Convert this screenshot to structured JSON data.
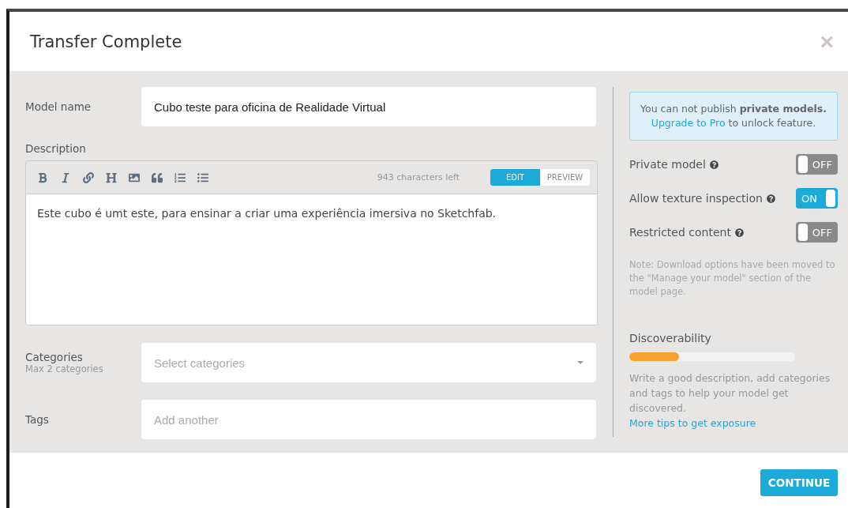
{
  "dialog": {
    "title": "Transfer Complete",
    "close": "×"
  },
  "form": {
    "model_name": {
      "label": "Model name",
      "value": "Cubo teste para oficina de Realidade Virtual"
    },
    "description": {
      "label": "Description",
      "chars_left": "943 characters left",
      "tabs": [
        {
          "label": "EDIT",
          "selected": true
        },
        {
          "label": "PREVIEW",
          "selected": false
        }
      ],
      "value": "Este cubo é umt este, para ensinar a criar uma experiência imersiva no Sketchfab."
    },
    "categories": {
      "label": "Categories",
      "hint": "Max 2 categories",
      "placeholder": "Select categories"
    },
    "tags": {
      "label": "Tags",
      "placeholder": "Add another"
    }
  },
  "sidebar": {
    "notice": {
      "text": "You can not publish **private models.**",
      "link": "Upgrade to Pro",
      "text_after": "to unlock feature."
    },
    "toggles": [
      {
        "label": "Private model",
        "on": false,
        "state": "OFF"
      },
      {
        "label": "Allow texture inspection",
        "on": true,
        "state": "ON"
      },
      {
        "label": "Restricted content",
        "on": false,
        "state": "OFF"
      }
    ],
    "note": "Note: Download options have been moved to the \"Manage your model\" section of the model page.",
    "discoverability": {
      "title": "Discoverability",
      "level": 0.3,
      "text": "Write a good description, add categories and tags to help your model get discovered.",
      "link": "More tips to get exposure"
    }
  },
  "footer": {
    "button": "CONTINUE"
  }
}
